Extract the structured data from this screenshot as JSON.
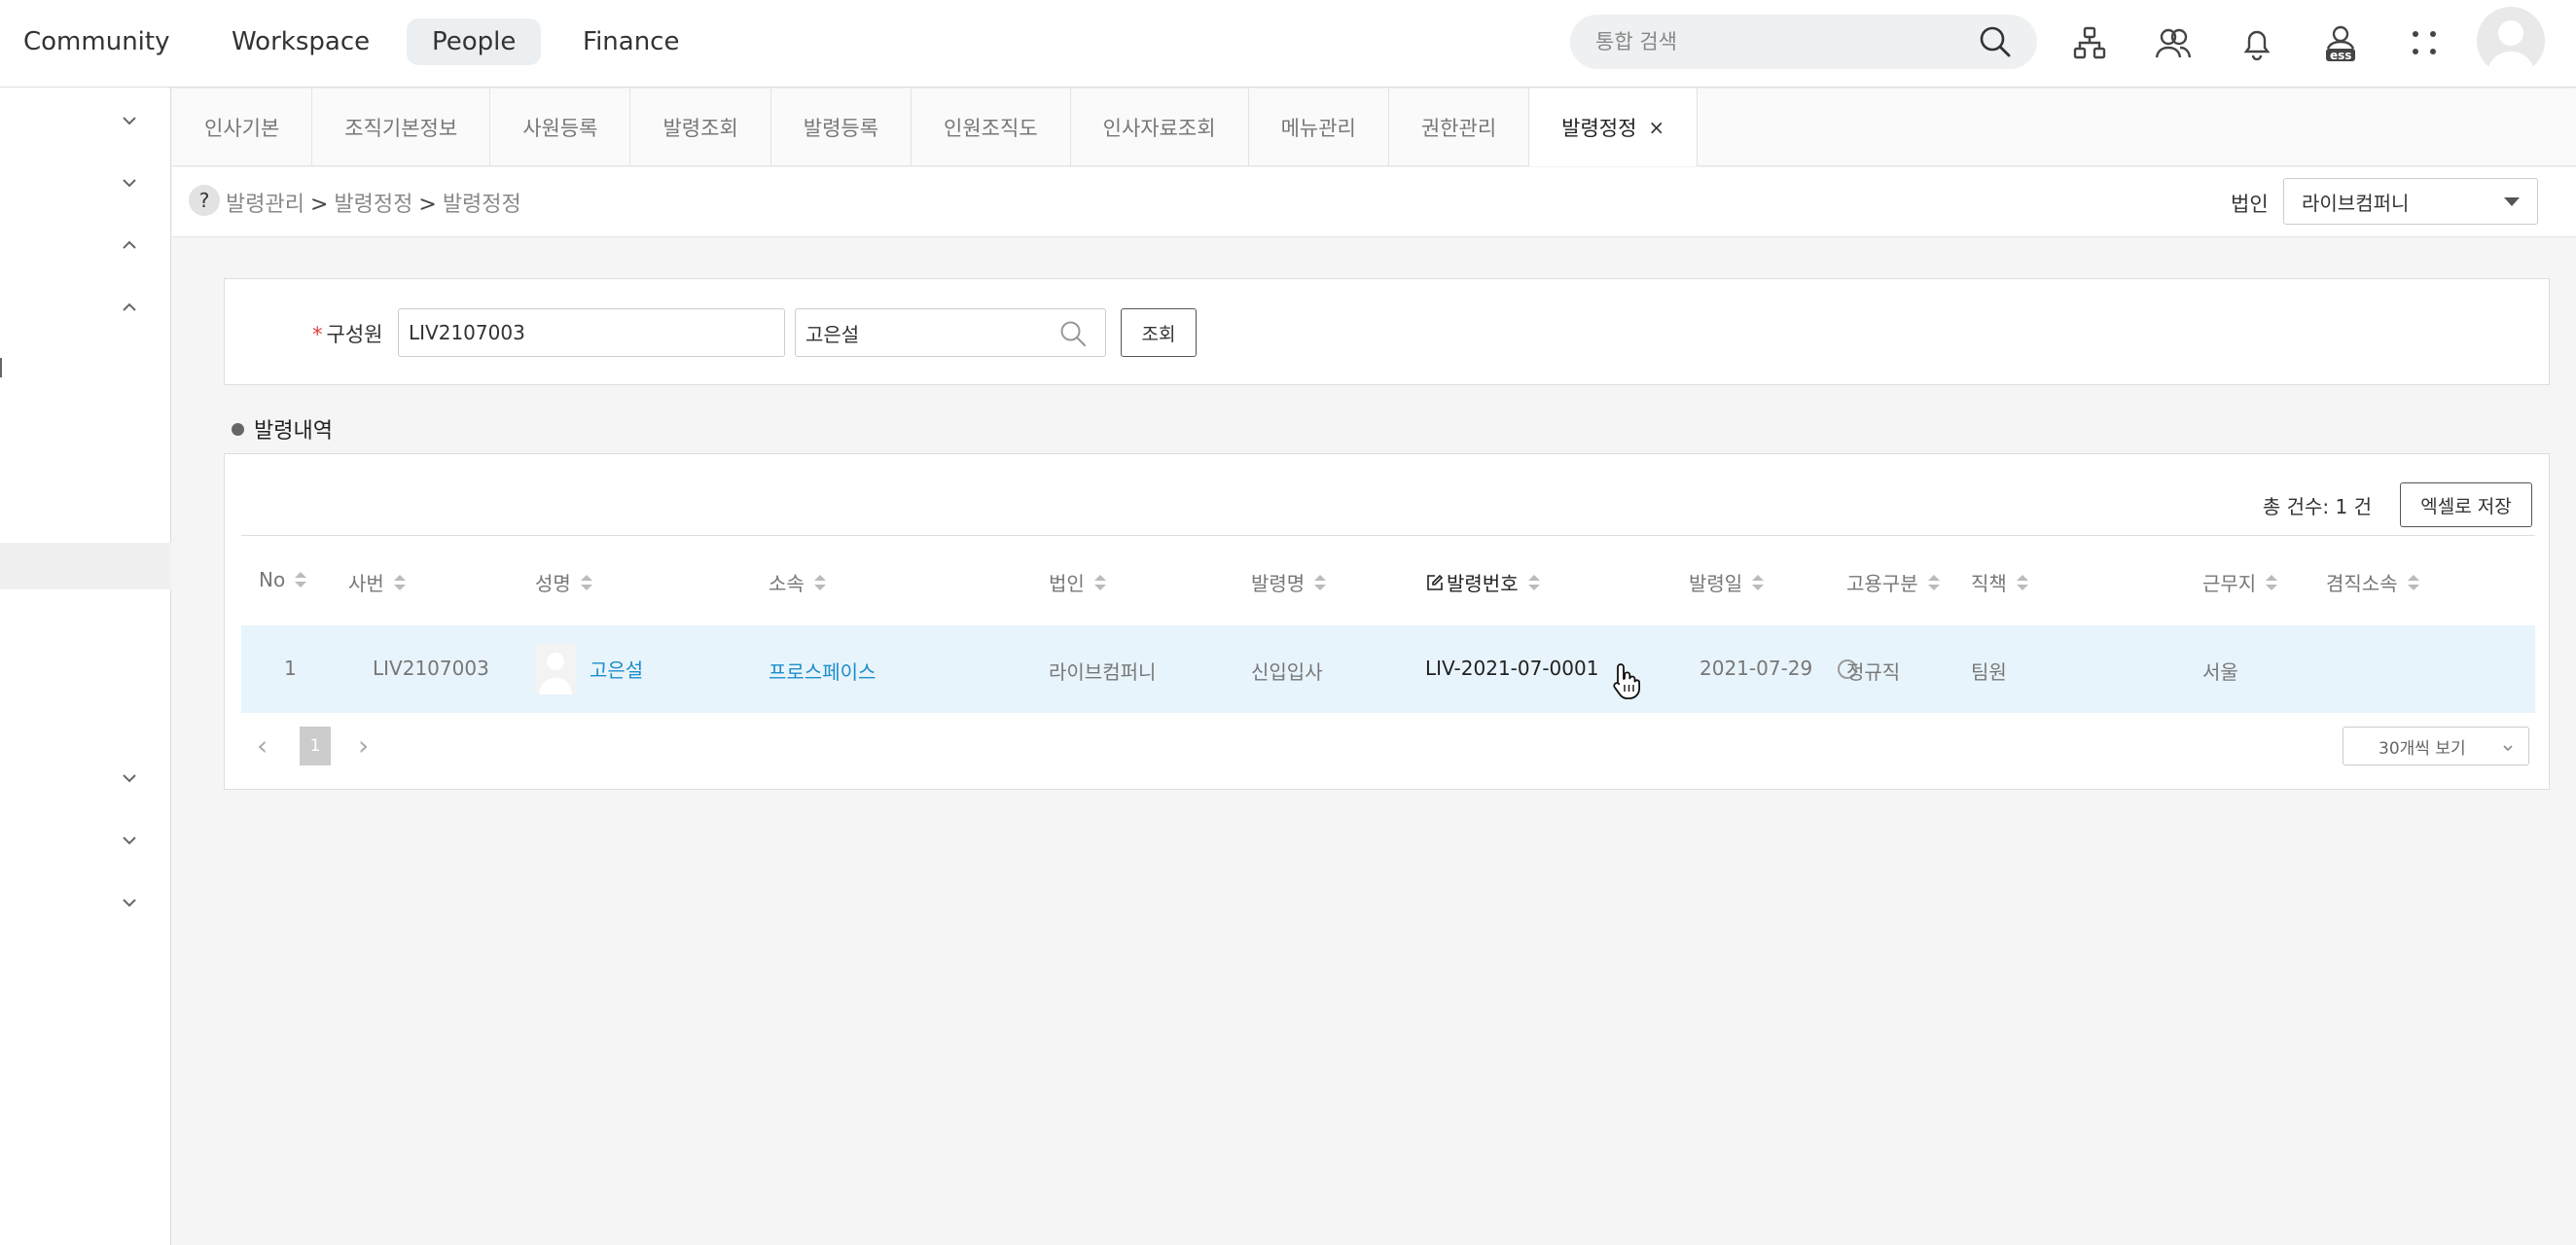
{
  "topnav": {
    "items": [
      {
        "label": "Community",
        "active": false
      },
      {
        "label": "Workspace",
        "active": false
      },
      {
        "label": "People",
        "active": true
      },
      {
        "label": "Finance",
        "active": false
      }
    ],
    "search_placeholder": "통합 검색",
    "icons": [
      "search-icon",
      "org-chart-icon",
      "people-icon",
      "bell-icon",
      "ess-icon",
      "apps-grid-icon",
      "avatar"
    ],
    "ess_label": "ess"
  },
  "tabs": [
    {
      "label": "인사기본",
      "active": false
    },
    {
      "label": "조직기본정보",
      "active": false
    },
    {
      "label": "사원등록",
      "active": false
    },
    {
      "label": "발령조회",
      "active": false
    },
    {
      "label": "발령등록",
      "active": false
    },
    {
      "label": "인원조직도",
      "active": false
    },
    {
      "label": "인사자료조회",
      "active": false
    },
    {
      "label": "메뉴관리",
      "active": false
    },
    {
      "label": "권한관리",
      "active": false
    },
    {
      "label": "발령정정",
      "active": true,
      "close": "×"
    }
  ],
  "breadcrumb": {
    "help": "?",
    "items": [
      "발령관리",
      "발령정정",
      "발령정정"
    ],
    "separator": ">"
  },
  "corp": {
    "label": "법인",
    "value": "라이브컴퍼니"
  },
  "search": {
    "required_mark": "*",
    "label": "구성원",
    "emp_id": "LIV2107003",
    "emp_name": "고은설",
    "button": "조회"
  },
  "section_title": "발령내역",
  "results": {
    "total": "총 건수: 1 건",
    "export_button": "엑셀로 저장",
    "columns": [
      "No",
      "사번",
      "성명",
      "소속",
      "법인",
      "발령명",
      "발령번호",
      "발령일",
      "고용구분",
      "직책",
      "근무지",
      "겸직소속"
    ],
    "rows": [
      {
        "no": "1",
        "emp_id": "LIV2107003",
        "name": "고은설",
        "dept": "프로스페이스",
        "corp": "라이브컴퍼니",
        "order_name": "신입입사",
        "order_no": "LIV-2021-07-0001",
        "order_date": "2021-07-29",
        "emp_type": "정규직",
        "position": "팀원",
        "location": "서울",
        "concurrent": ""
      }
    ],
    "pagination": {
      "prev": "‹",
      "current": "1",
      "next": "›",
      "page_size": "30개씩 보기"
    }
  }
}
